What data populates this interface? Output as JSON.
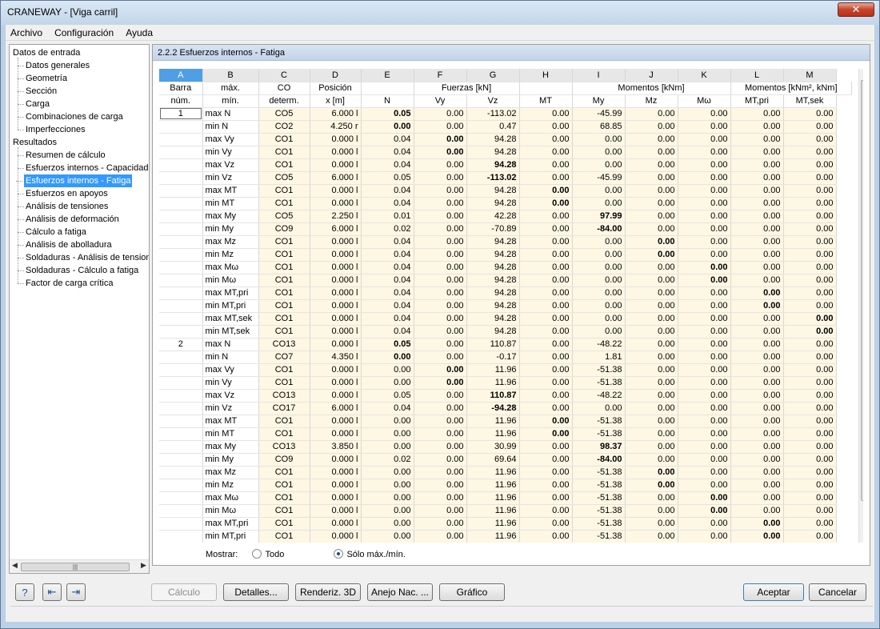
{
  "window": {
    "title": "CRANEWAY - [Viga carril]"
  },
  "menu": [
    "Archivo",
    "Configuración",
    "Ayuda"
  ],
  "tree": {
    "input_root": "Datos de entrada",
    "input_items": [
      "Datos generales",
      "Geometría",
      "Sección",
      "Carga",
      "Combinaciones de carga",
      "Imperfecciones"
    ],
    "results_root": "Resultados",
    "results_items": [
      "Resumen de cálculo",
      "Esfuerzos internos - Capacidad",
      "Esfuerzos internos - Fatiga",
      "Esfuerzos en apoyos",
      "Análisis de tensiones",
      "Análisis de deformación",
      "Cálculo a fatiga",
      "Análisis de abolladura",
      "Soldaduras - Análisis de tensione",
      "Soldaduras - Cálculo a fatiga",
      "Factor de carga crítica"
    ],
    "selected": "Esfuerzos internos - Fatiga"
  },
  "panel": {
    "title": "2.2.2 Esfuerzos internos - Fatiga"
  },
  "grid": {
    "letters": [
      "A",
      "B",
      "C",
      "D",
      "E",
      "F",
      "G",
      "H",
      "I",
      "J",
      "K",
      "L",
      "M"
    ],
    "header1": {
      "a": "Barra",
      "b": "máx.",
      "c": "CO",
      "d": "Posición",
      "fuerzas": "Fuerzas [kN]",
      "momentos": "Momentos [kNm]",
      "momentos2": "Momentos [kNm², kNm]"
    },
    "header2": {
      "a": "núm.",
      "b": "mín.",
      "c": "determ.",
      "d": "x [m]",
      "e": "N",
      "f": "Vy",
      "g": "Vz",
      "h": "MT",
      "i": "My",
      "j": "Mz",
      "k": "Mω",
      "l": "MT,pri",
      "m": "MT,sek"
    },
    "rows": [
      [
        "1",
        "max N",
        "CO5",
        "6.000 l",
        "0.05",
        "0.00",
        "-113.02",
        "0.00",
        "-45.99",
        "0.00",
        "0.00",
        "0.00",
        "0.00",
        "E"
      ],
      [
        "",
        "min N",
        "CO2",
        "4.250 r",
        "0.00",
        "0.00",
        "0.47",
        "0.00",
        "68.85",
        "0.00",
        "0.00",
        "0.00",
        "0.00",
        "E"
      ],
      [
        "",
        "max Vy",
        "CO1",
        "0.000 l",
        "0.04",
        "0.00",
        "94.28",
        "0.00",
        "0.00",
        "0.00",
        "0.00",
        "0.00",
        "0.00",
        "F"
      ],
      [
        "",
        "min Vy",
        "CO1",
        "0.000 l",
        "0.04",
        "0.00",
        "94.28",
        "0.00",
        "0.00",
        "0.00",
        "0.00",
        "0.00",
        "0.00",
        "F"
      ],
      [
        "",
        "max Vz",
        "CO1",
        "0.000 l",
        "0.04",
        "0.00",
        "94.28",
        "0.00",
        "0.00",
        "0.00",
        "0.00",
        "0.00",
        "0.00",
        "G"
      ],
      [
        "",
        "min Vz",
        "CO5",
        "6.000 l",
        "0.05",
        "0.00",
        "-113.02",
        "0.00",
        "-45.99",
        "0.00",
        "0.00",
        "0.00",
        "0.00",
        "G"
      ],
      [
        "",
        "max MT",
        "CO1",
        "0.000 l",
        "0.04",
        "0.00",
        "94.28",
        "0.00",
        "0.00",
        "0.00",
        "0.00",
        "0.00",
        "0.00",
        "H"
      ],
      [
        "",
        "min MT",
        "CO1",
        "0.000 l",
        "0.04",
        "0.00",
        "94.28",
        "0.00",
        "0.00",
        "0.00",
        "0.00",
        "0.00",
        "0.00",
        "H"
      ],
      [
        "",
        "max My",
        "CO5",
        "2.250 l",
        "0.01",
        "0.00",
        "42.28",
        "0.00",
        "97.99",
        "0.00",
        "0.00",
        "0.00",
        "0.00",
        "I"
      ],
      [
        "",
        "min My",
        "CO9",
        "6.000 l",
        "0.02",
        "0.00",
        "-70.89",
        "0.00",
        "-84.00",
        "0.00",
        "0.00",
        "0.00",
        "0.00",
        "I"
      ],
      [
        "",
        "max Mz",
        "CO1",
        "0.000 l",
        "0.04",
        "0.00",
        "94.28",
        "0.00",
        "0.00",
        "0.00",
        "0.00",
        "0.00",
        "0.00",
        "J"
      ],
      [
        "",
        "min Mz",
        "CO1",
        "0.000 l",
        "0.04",
        "0.00",
        "94.28",
        "0.00",
        "0.00",
        "0.00",
        "0.00",
        "0.00",
        "0.00",
        "J"
      ],
      [
        "",
        "max Mω",
        "CO1",
        "0.000 l",
        "0.04",
        "0.00",
        "94.28",
        "0.00",
        "0.00",
        "0.00",
        "0.00",
        "0.00",
        "0.00",
        "K"
      ],
      [
        "",
        "min Mω",
        "CO1",
        "0.000 l",
        "0.04",
        "0.00",
        "94.28",
        "0.00",
        "0.00",
        "0.00",
        "0.00",
        "0.00",
        "0.00",
        "K"
      ],
      [
        "",
        "max MT,pri",
        "CO1",
        "0.000 l",
        "0.04",
        "0.00",
        "94.28",
        "0.00",
        "0.00",
        "0.00",
        "0.00",
        "0.00",
        "0.00",
        "L"
      ],
      [
        "",
        "min MT,pri",
        "CO1",
        "0.000 l",
        "0.04",
        "0.00",
        "94.28",
        "0.00",
        "0.00",
        "0.00",
        "0.00",
        "0.00",
        "0.00",
        "L"
      ],
      [
        "",
        "max MT,sek",
        "CO1",
        "0.000 l",
        "0.04",
        "0.00",
        "94.28",
        "0.00",
        "0.00",
        "0.00",
        "0.00",
        "0.00",
        "0.00",
        "M"
      ],
      [
        "",
        "min MT,sek",
        "CO1",
        "0.000 l",
        "0.04",
        "0.00",
        "94.28",
        "0.00",
        "0.00",
        "0.00",
        "0.00",
        "0.00",
        "0.00",
        "M"
      ],
      [
        "2",
        "max N",
        "CO13",
        "0.000 l",
        "0.05",
        "0.00",
        "110.87",
        "0.00",
        "-48.22",
        "0.00",
        "0.00",
        "0.00",
        "0.00",
        "E"
      ],
      [
        "",
        "min N",
        "CO7",
        "4.350 l",
        "0.00",
        "0.00",
        "-0.17",
        "0.00",
        "1.81",
        "0.00",
        "0.00",
        "0.00",
        "0.00",
        "E"
      ],
      [
        "",
        "max Vy",
        "CO1",
        "0.000 l",
        "0.00",
        "0.00",
        "11.96",
        "0.00",
        "-51.38",
        "0.00",
        "0.00",
        "0.00",
        "0.00",
        "F"
      ],
      [
        "",
        "min Vy",
        "CO1",
        "0.000 l",
        "0.00",
        "0.00",
        "11.96",
        "0.00",
        "-51.38",
        "0.00",
        "0.00",
        "0.00",
        "0.00",
        "F"
      ],
      [
        "",
        "max Vz",
        "CO13",
        "0.000 l",
        "0.05",
        "0.00",
        "110.87",
        "0.00",
        "-48.22",
        "0.00",
        "0.00",
        "0.00",
        "0.00",
        "G"
      ],
      [
        "",
        "min Vz",
        "CO17",
        "6.000 l",
        "0.04",
        "0.00",
        "-94.28",
        "0.00",
        "0.00",
        "0.00",
        "0.00",
        "0.00",
        "0.00",
        "G"
      ],
      [
        "",
        "max MT",
        "CO1",
        "0.000 l",
        "0.00",
        "0.00",
        "11.96",
        "0.00",
        "-51.38",
        "0.00",
        "0.00",
        "0.00",
        "0.00",
        "H"
      ],
      [
        "",
        "min MT",
        "CO1",
        "0.000 l",
        "0.00",
        "0.00",
        "11.96",
        "0.00",
        "-51.38",
        "0.00",
        "0.00",
        "0.00",
        "0.00",
        "H"
      ],
      [
        "",
        "max My",
        "CO13",
        "3.850 l",
        "0.00",
        "0.00",
        "30.99",
        "0.00",
        "98.37",
        "0.00",
        "0.00",
        "0.00",
        "0.00",
        "I"
      ],
      [
        "",
        "min My",
        "CO9",
        "0.000 l",
        "0.02",
        "0.00",
        "69.64",
        "0.00",
        "-84.00",
        "0.00",
        "0.00",
        "0.00",
        "0.00",
        "I"
      ],
      [
        "",
        "max Mz",
        "CO1",
        "0.000 l",
        "0.00",
        "0.00",
        "11.96",
        "0.00",
        "-51.38",
        "0.00",
        "0.00",
        "0.00",
        "0.00",
        "J"
      ],
      [
        "",
        "min Mz",
        "CO1",
        "0.000 l",
        "0.00",
        "0.00",
        "11.96",
        "0.00",
        "-51.38",
        "0.00",
        "0.00",
        "0.00",
        "0.00",
        "J"
      ],
      [
        "",
        "max Mω",
        "CO1",
        "0.000 l",
        "0.00",
        "0.00",
        "11.96",
        "0.00",
        "-51.38",
        "0.00",
        "0.00",
        "0.00",
        "0.00",
        "K"
      ],
      [
        "",
        "min Mω",
        "CO1",
        "0.000 l",
        "0.00",
        "0.00",
        "11.96",
        "0.00",
        "-51.38",
        "0.00",
        "0.00",
        "0.00",
        "0.00",
        "K"
      ],
      [
        "",
        "max MT,pri",
        "CO1",
        "0.000 l",
        "0.00",
        "0.00",
        "11.96",
        "0.00",
        "-51.38",
        "0.00",
        "0.00",
        "0.00",
        "0.00",
        "L"
      ],
      [
        "",
        "min MT,pri",
        "CO1",
        "0.000 l",
        "0.00",
        "0.00",
        "11.96",
        "0.00",
        "-51.38",
        "0.00",
        "0.00",
        "0.00",
        "0.00",
        "L"
      ]
    ]
  },
  "mostrar": {
    "label": "Mostrar:",
    "opt_all": "Todo",
    "opt_max": "Sólo máx./mín.",
    "selected": "Sólo máx./mín."
  },
  "buttons": {
    "calculo": "Cálculo",
    "detalles": "Detalles...",
    "renderiz": "Renderiz. 3D",
    "anejo": "Anejo Nac. ...",
    "grafico": "Gráfico",
    "aceptar": "Aceptar",
    "cancelar": "Cancelar"
  },
  "icons": [
    "help-icon",
    "import-icon",
    "export-icon"
  ]
}
